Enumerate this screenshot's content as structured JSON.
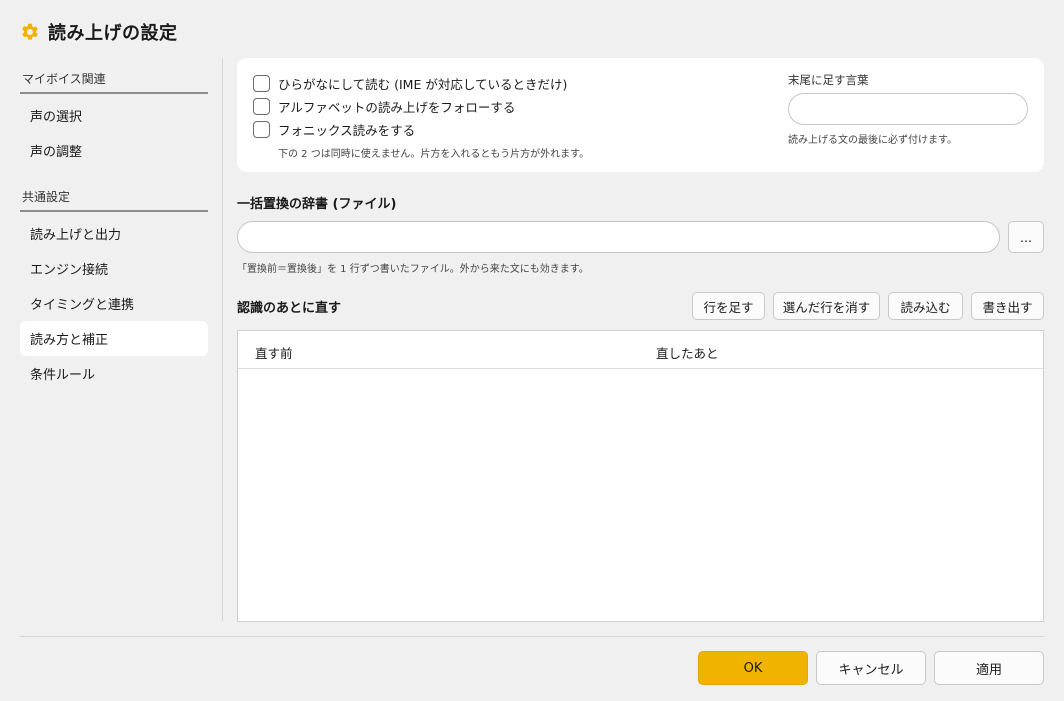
{
  "window": {
    "title": "読み上げの設定",
    "icon": "gear-icon",
    "accent_color": "#f0b400"
  },
  "sidebar": {
    "sections": [
      {
        "label": "マイボイス関連",
        "items": [
          {
            "label": "声の選択"
          },
          {
            "label": "声の調整"
          }
        ]
      },
      {
        "label": "共通設定",
        "items": [
          {
            "label": "読み上げと出力"
          },
          {
            "label": "エンジン接続"
          },
          {
            "label": "タイミングと連携"
          },
          {
            "label": "読み方と補正",
            "selected": true
          },
          {
            "label": "条件ルール"
          }
        ]
      }
    ]
  },
  "options": {
    "checkboxes": [
      {
        "label": "ひらがなにして読む (IME が対応しているときだけ)",
        "checked": false
      },
      {
        "label": "アルファベットの読み上げをフォローする",
        "checked": false
      },
      {
        "label": "フォニックス読みをする",
        "checked": false
      }
    ],
    "note": "下の 2 つは同時に使えません。片方を入れるともう片方が外れます。",
    "suffix": {
      "label": "末尾に足す言葉",
      "value": "",
      "hint": "読み上げる文の最後に必ず付けます。"
    }
  },
  "dictionary": {
    "heading": "一括置換の辞書 (ファイル)",
    "path_value": "",
    "browse_label": "...",
    "hint": "「置換前＝置換後」を 1 行ずつ書いたファイル。外から来た文にも効きます。"
  },
  "corrections": {
    "heading": "認識のあとに直す",
    "buttons": {
      "add": "行を足す",
      "remove": "選んだ行を消す",
      "import": "読み込む",
      "export": "書き出す"
    },
    "columns": [
      "直す前",
      "直したあと"
    ],
    "rows": []
  },
  "footer": {
    "ok": "OK",
    "cancel": "キャンセル",
    "apply": "適用"
  }
}
